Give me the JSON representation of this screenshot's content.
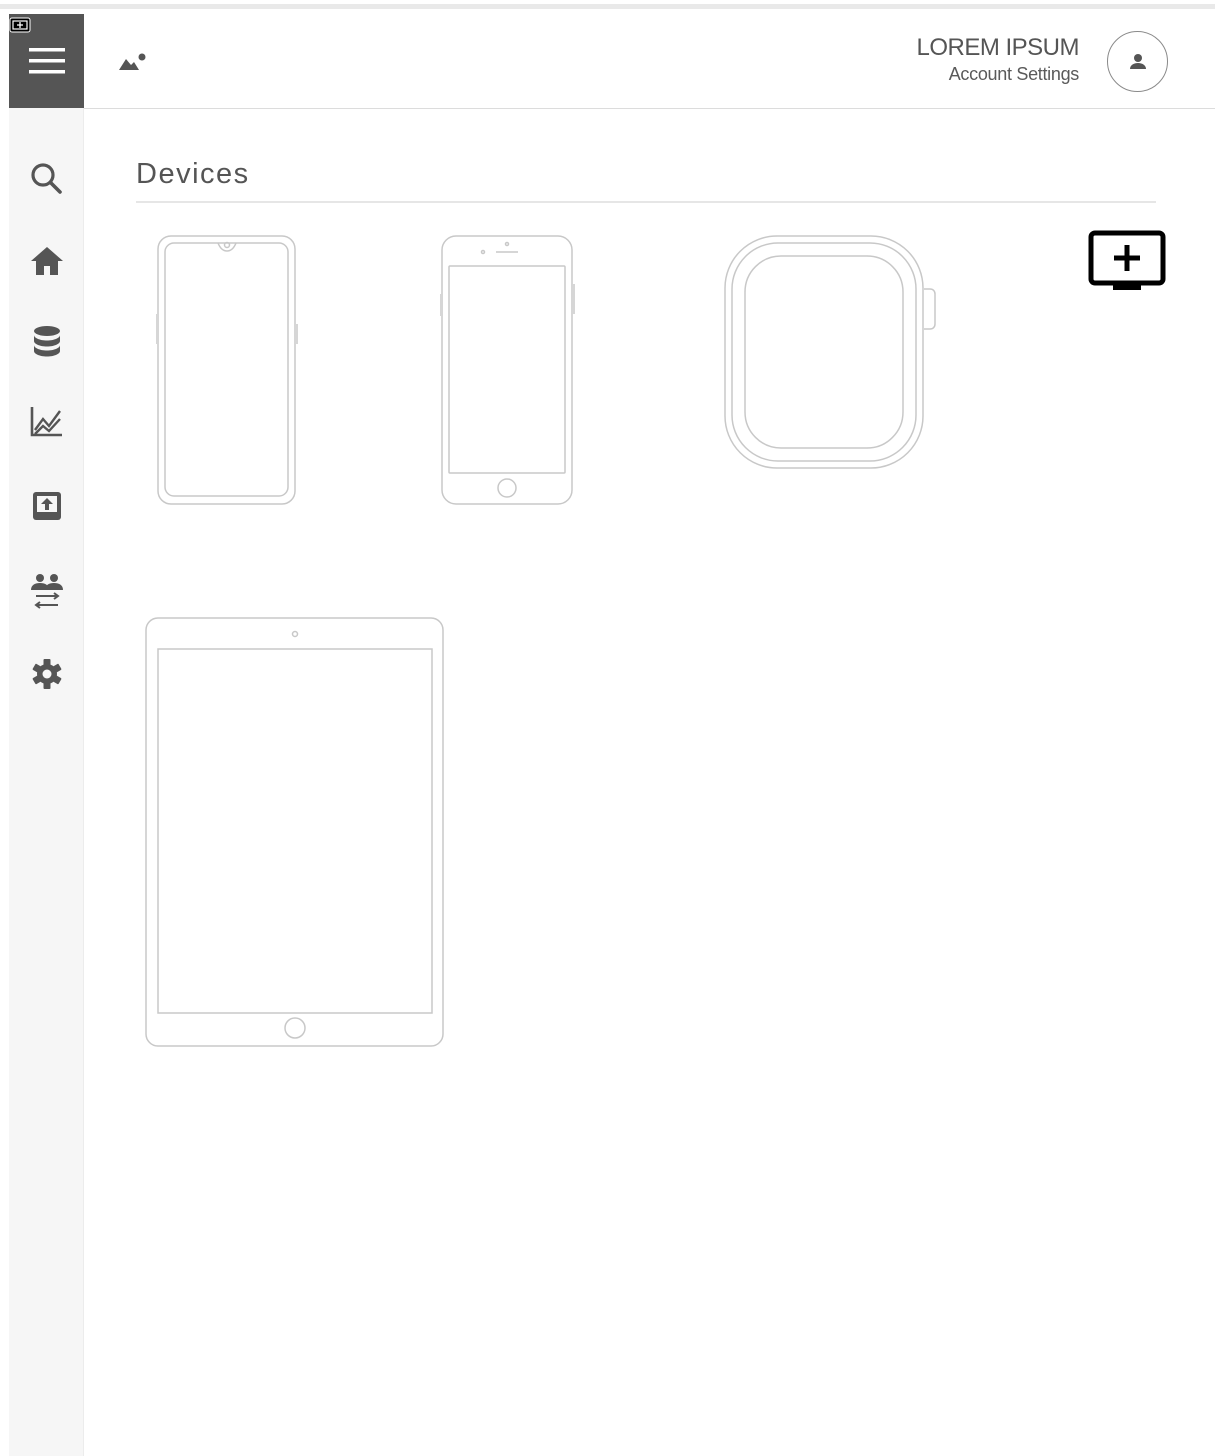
{
  "header": {
    "user_name": "LOREM IPSUM",
    "user_subtitle": "Account Settings",
    "logo_icon": "image-icon",
    "avatar_icon": "user-icon"
  },
  "sidebar": {
    "menu_icon": "hamburger-icon",
    "items": [
      {
        "id": "search",
        "icon": "search-icon"
      },
      {
        "id": "home",
        "icon": "home-icon"
      },
      {
        "id": "database",
        "icon": "database-icon"
      },
      {
        "id": "analytics",
        "icon": "chart-icon"
      },
      {
        "id": "upload",
        "icon": "upload-icon"
      },
      {
        "id": "users",
        "icon": "users-transfer-icon"
      },
      {
        "id": "settings",
        "icon": "gear-icon"
      }
    ]
  },
  "main": {
    "title": "Devices",
    "add_icon": "add-device-icon",
    "devices": [
      {
        "id": "android-phone",
        "icon": "android-phone-icon"
      },
      {
        "id": "iphone",
        "icon": "iphone-icon"
      },
      {
        "id": "smartwatch",
        "icon": "smartwatch-icon"
      },
      {
        "id": "tablet",
        "icon": "tablet-icon"
      }
    ]
  },
  "colors": {
    "sidebar_bg": "#f6f6f6",
    "menu_bg": "#555555",
    "icon": "#555555",
    "device_outline": "#c8c8c8"
  }
}
